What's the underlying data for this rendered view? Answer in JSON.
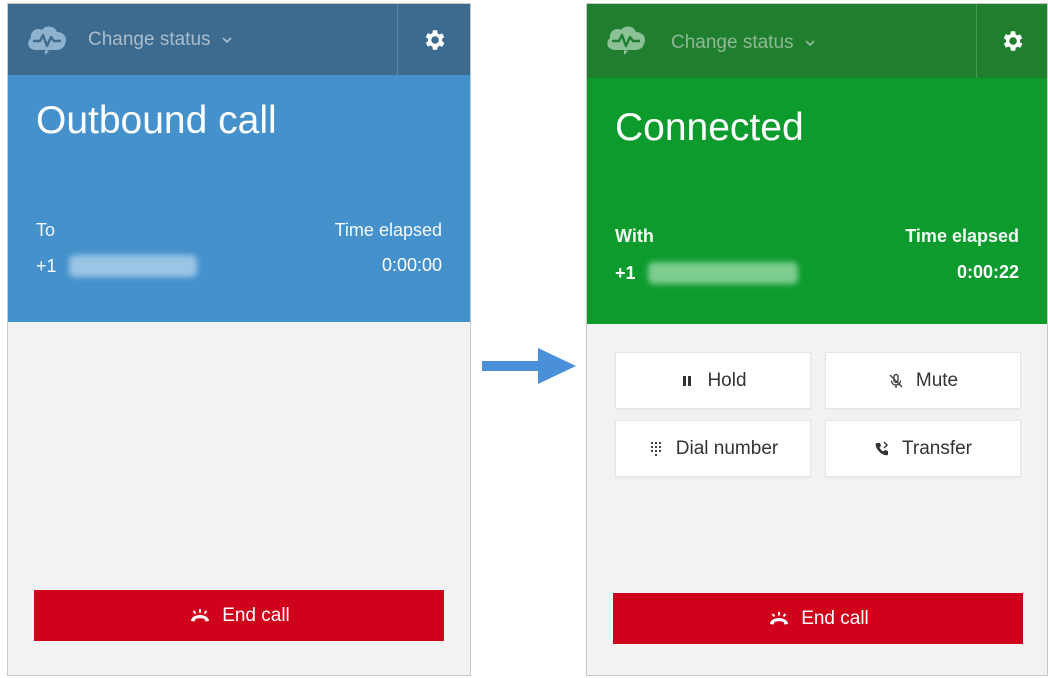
{
  "colors": {
    "left_header": "#3d6a8f",
    "left_state": "#4591cc",
    "right_header": "#1f7f2f",
    "right_state": "#0e9b2e",
    "end_call": "#d0021b",
    "arrow": "#4a90d9"
  },
  "left": {
    "status_label": "Change status",
    "state_title": "Outbound call",
    "info_label": "To",
    "number_prefix": "+1",
    "time_label": "Time elapsed",
    "time_value": "0:00:00",
    "end_call_label": "End call"
  },
  "right": {
    "status_label": "Change status",
    "state_title": "Connected",
    "info_label": "With",
    "number_prefix": "+1",
    "time_label": "Time elapsed",
    "time_value": "0:00:22",
    "actions": [
      {
        "label": "Hold",
        "icon": "pause-icon"
      },
      {
        "label": "Mute",
        "icon": "mic-off-icon"
      },
      {
        "label": "Dial number",
        "icon": "keypad-icon"
      },
      {
        "label": "Transfer",
        "icon": "transfer-icon"
      }
    ],
    "end_call_label": "End call"
  }
}
